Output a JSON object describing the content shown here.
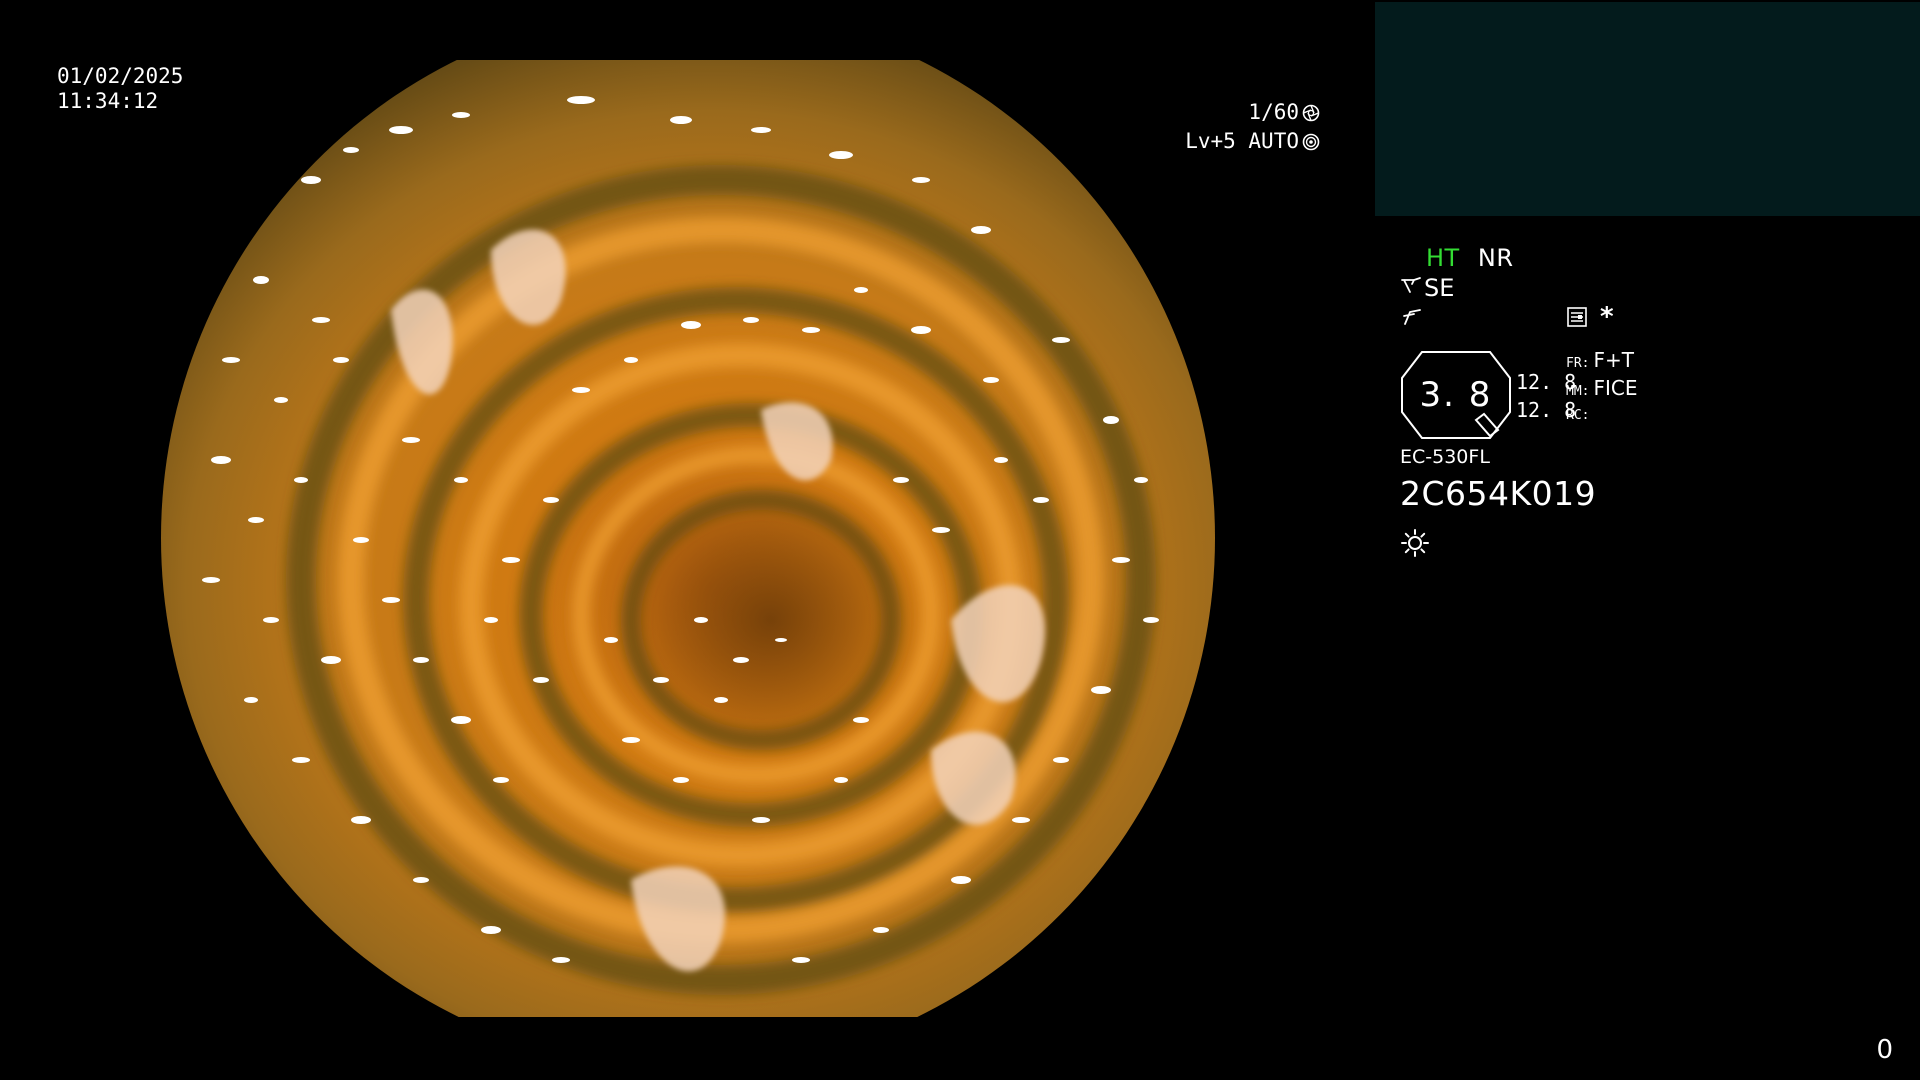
{
  "overlay": {
    "date": "01/02/2025",
    "time": "11:34:12",
    "shutter": "1/60",
    "shutter_icon": "aperture-icon",
    "iris": "Lv+5 AUTO",
    "iris_icon": "iris-icon"
  },
  "preview_panel": {
    "background": "#031b1c"
  },
  "image_modes": {
    "ht": "HT",
    "ht_color": "#33dd33",
    "nr": "NR",
    "se": "SE",
    "se_icon": "scope-enhance-icon",
    "structure_icon": "structure-enhance-icon",
    "record_icon": "document-icon",
    "asterisk": "*"
  },
  "zoom": {
    "value": "3. 8",
    "gain_upper": "12. 8",
    "gain_lower": "12. 8"
  },
  "settings": [
    {
      "key": "FR:",
      "value": "F+T"
    },
    {
      "key": "MM:",
      "value": "FICE"
    },
    {
      "key": "RC:",
      "value": ""
    }
  ],
  "scope": {
    "model": "EC-530FL",
    "serial": "2C654K019",
    "light_icon": "light-source-icon"
  },
  "corner": {
    "count": "0"
  }
}
